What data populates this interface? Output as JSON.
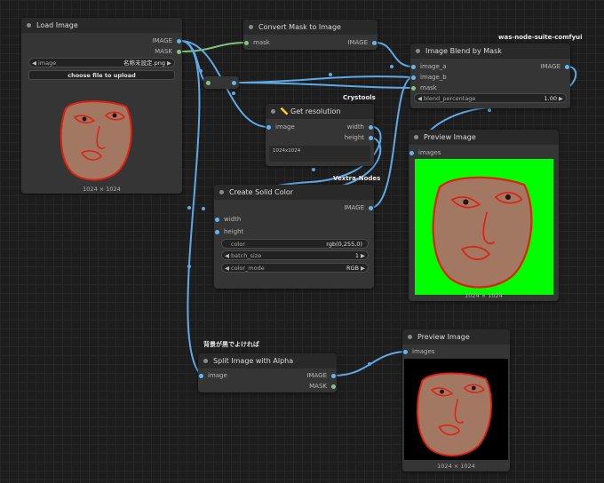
{
  "colors": {
    "image_slot": "#64b5f6",
    "mask_slot": "#81c784",
    "int_slot": "#64b5f6",
    "wire_image": "#5ea9e6",
    "wire_mask": "#7cc47f",
    "preview1_bg": "#00ff00",
    "preview2_bg": "#000000",
    "face_fill": "#a27863",
    "face_stroke": "#e02010"
  },
  "load_image": {
    "title": "Load Image",
    "out_image": "IMAGE",
    "out_mask": "MASK",
    "widget_label": "image",
    "widget_value": "名称未設定.png",
    "upload_button": "choose file to upload",
    "size": "1024 × 1024"
  },
  "convert_mask": {
    "title": "Convert Mask to Image",
    "in_mask": "mask",
    "out_image": "IMAGE"
  },
  "get_resolution": {
    "badge": "Crystools",
    "title": "Get resolution",
    "in_image": "image",
    "out_width": "width",
    "out_height": "height",
    "text": "1024x1024"
  },
  "image_blend": {
    "badge": "was-node-suite-comfyui",
    "title": "Image Blend by Mask",
    "in_a": "image_a",
    "in_b": "image_b",
    "in_mask": "mask",
    "out_image": "IMAGE",
    "widget_label": "blend_percentage",
    "widget_value": "1.00"
  },
  "preview1": {
    "title": "Preview Image",
    "in_images": "images",
    "size": "1024 × 1024"
  },
  "solid_color": {
    "badge": "Vextra-Nodes",
    "title": "Create Solid Color",
    "out_image": "IMAGE",
    "in_width": "width",
    "in_height": "height",
    "color_label": "color",
    "color_value": "rgb(0,255,0)",
    "batch_label": "batch_size",
    "batch_value": "1",
    "mode_label": "color_mode",
    "mode_value": "RGB"
  },
  "split_alpha": {
    "note": "背景が黒でよければ",
    "title": "Split Image with Alpha",
    "in_image": "image",
    "out_image": "IMAGE",
    "out_mask": "MASK"
  },
  "preview2": {
    "title": "Preview Image",
    "in_images": "images",
    "size": "1024 × 1024"
  }
}
